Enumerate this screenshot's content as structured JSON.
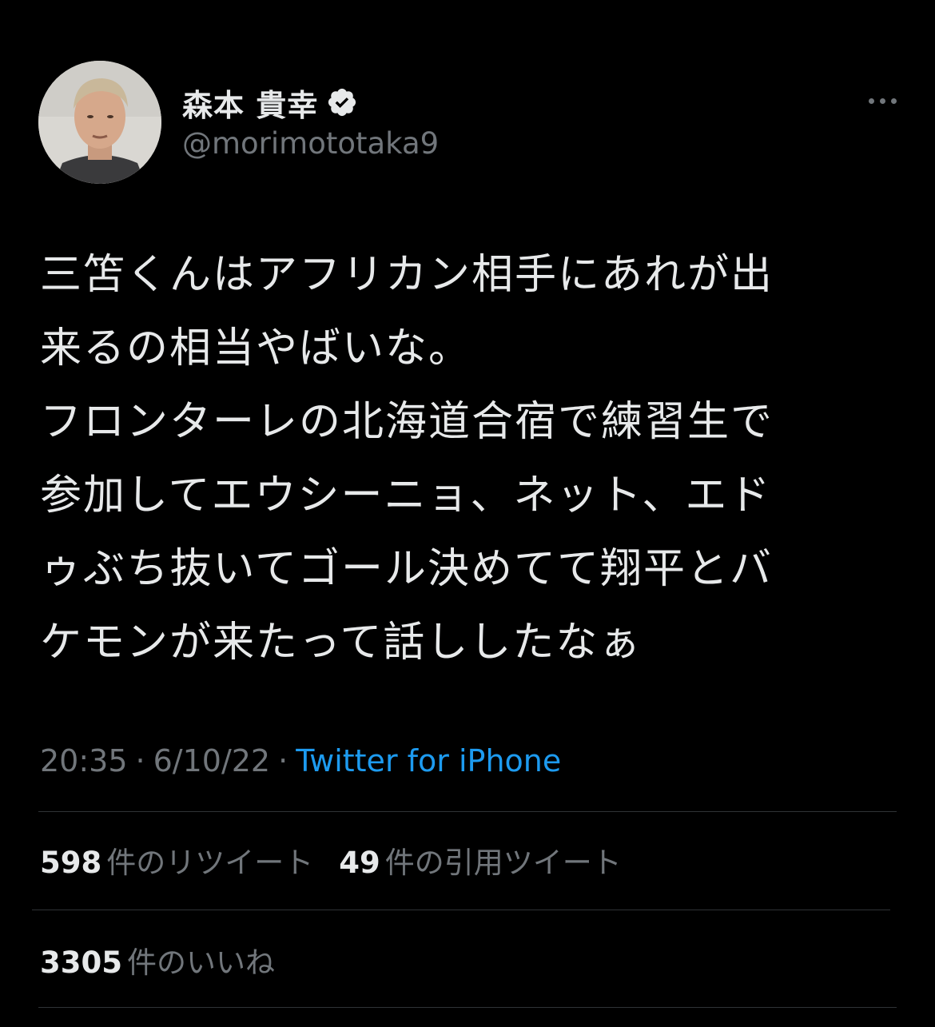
{
  "author": {
    "display_name": "森本 貴幸",
    "handle": "@morimototaka9",
    "verified": true,
    "avatar": "profile-photo"
  },
  "tweet": {
    "lines": [
      "三笘くんはアフリカン相手にあれが出",
      "来るの相当やばいな。",
      "フロンターレの北海道合宿で練習生で",
      "参加してエウシーニョ、ネット、エド",
      "ゥぶち抜いてゴール決めてて翔平とバ",
      "ケモンが来たって話ししたなぁ"
    ],
    "time": "20:35",
    "separator": "·",
    "date": "6/10/22",
    "source": "Twitter for iPhone"
  },
  "stats": {
    "retweets_count": "598",
    "retweets_label": "件のリツイート",
    "quotes_count": "49",
    "quotes_label": "件の引用ツイート",
    "likes_count": "3305",
    "likes_label": "件のいいね"
  },
  "colors": {
    "background": "#000000",
    "text_primary": "#e7e9ea",
    "text_secondary": "#71767b",
    "link": "#1d9bf0",
    "divider": "#2f3336"
  },
  "icons": {
    "verified": "verified-badge-icon",
    "more": "more-horizontal-icon"
  }
}
